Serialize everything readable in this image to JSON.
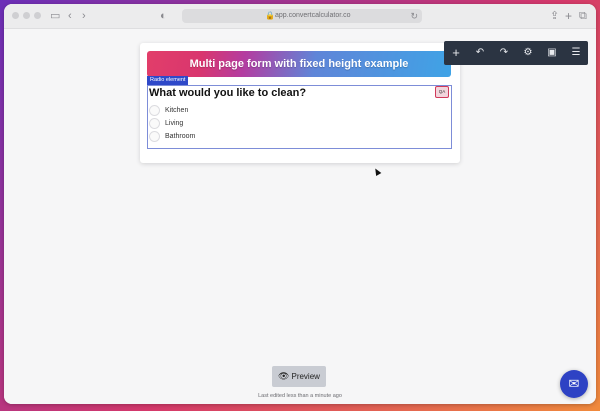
{
  "browser": {
    "url": "app.convertcalculator.co",
    "icons": {
      "sidebar": "sidebar-icon",
      "back": "chevron-left-icon",
      "forward": "chevron-right-icon",
      "privacy": "shield-icon",
      "lock": "lock-icon",
      "reload": "reload-icon",
      "share": "share-icon",
      "new_tab": "plus-icon",
      "tabs": "tabs-icon"
    }
  },
  "form": {
    "banner_title": "Multi page form with fixed height example",
    "element_tag": "Radio element",
    "question": "What would you like to clean?",
    "qa_badge": "QA",
    "options": [
      "Kitchen",
      "Living",
      "Bathroom"
    ]
  },
  "editor_toolbar": {
    "icons": [
      "plus-icon",
      "undo-icon",
      "redo-icon",
      "gear-icon",
      "save-icon",
      "menu-icon"
    ]
  },
  "footer": {
    "preview_label": "Preview",
    "last_edited": "Last edited less than a minute ago"
  },
  "colors": {
    "toolbar_bg": "#2b3442",
    "element_tag_bg": "#2f49c9",
    "chat_button": "#2e42c4",
    "qa_border": "#d03a5a"
  }
}
